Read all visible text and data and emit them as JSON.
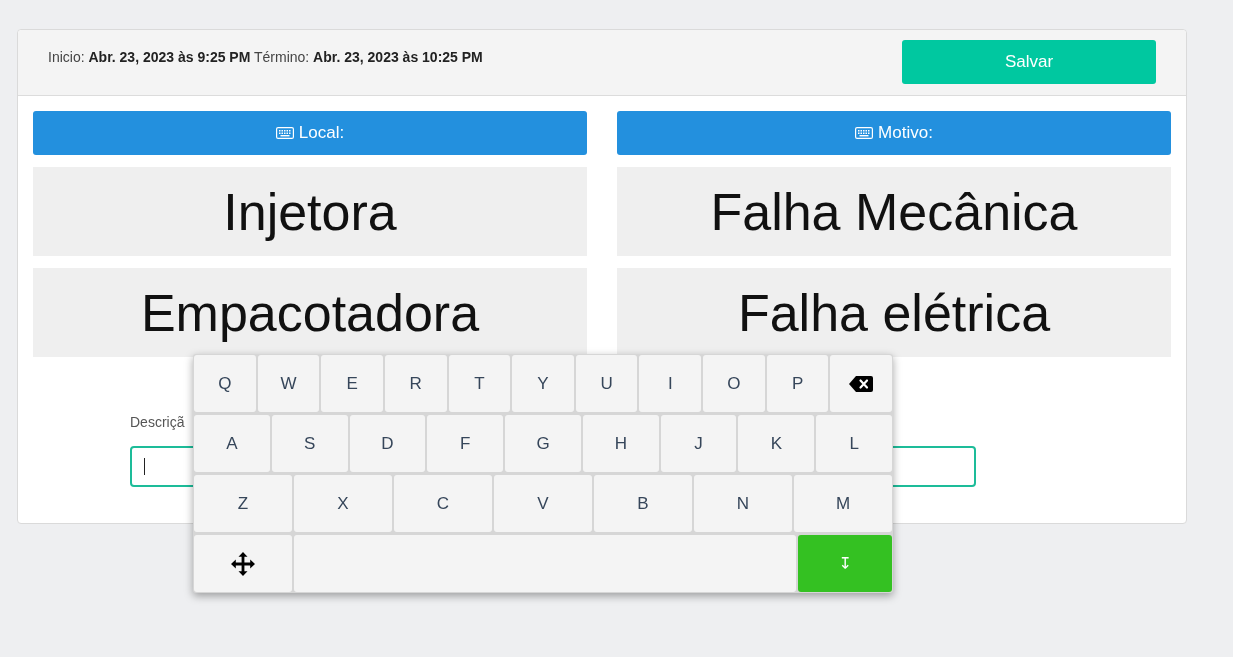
{
  "header": {
    "schedule": "Inicio: **Abr. 23, 2023 às 9:25 PM** Término: **Abr. 23, 2023 às 10:25 PM**",
    "save_button": "Salvar"
  },
  "columns": [
    {
      "title": "Local:",
      "options": [
        {
          "label": "Injetora",
          "selected": false
        },
        {
          "label": "Empacotadora",
          "selected": false
        }
      ]
    },
    {
      "title": "Motivo:",
      "options": [
        {
          "label": "Falha Mecânica",
          "selected": false
        },
        {
          "label": "Falha elétrica",
          "selected": false
        }
      ]
    }
  ],
  "description": {
    "label": "Descriçã",
    "focused": true
  },
  "keyboard": {
    "rows": [
      [
        {
          "kind": "letter",
          "label": "Q"
        },
        {
          "kind": "letter",
          "label": "W"
        },
        {
          "kind": "letter",
          "label": "E"
        },
        {
          "kind": "letter",
          "label": "R"
        },
        {
          "kind": "letter",
          "label": "T"
        },
        {
          "kind": "letter",
          "label": "Y"
        },
        {
          "kind": "letter",
          "label": "U"
        },
        {
          "kind": "letter",
          "label": "I"
        },
        {
          "kind": "letter",
          "label": "O"
        },
        {
          "kind": "letter",
          "label": "P"
        },
        {
          "kind": "backspace"
        }
      ],
      [
        {
          "kind": "letter",
          "label": "A"
        },
        {
          "kind": "letter",
          "label": "S"
        },
        {
          "kind": "letter",
          "label": "D"
        },
        {
          "kind": "letter",
          "label": "F"
        },
        {
          "kind": "letter",
          "label": "G"
        },
        {
          "kind": "letter",
          "label": "H"
        },
        {
          "kind": "letter",
          "label": "J"
        },
        {
          "kind": "letter",
          "label": "K"
        },
        {
          "kind": "letter",
          "label": "L"
        }
      ],
      [
        {
          "kind": "letter",
          "label": "Z"
        },
        {
          "kind": "letter",
          "label": "X"
        },
        {
          "kind": "letter",
          "label": "C"
        },
        {
          "kind": "letter",
          "label": "V"
        },
        {
          "kind": "letter",
          "label": "B"
        },
        {
          "kind": "letter",
          "label": "N"
        },
        {
          "kind": "letter",
          "label": "M"
        }
      ],
      [
        {
          "kind": "move"
        },
        {
          "kind": "space"
        },
        {
          "kind": "enter",
          "label": "↧"
        }
      ]
    ]
  }
}
